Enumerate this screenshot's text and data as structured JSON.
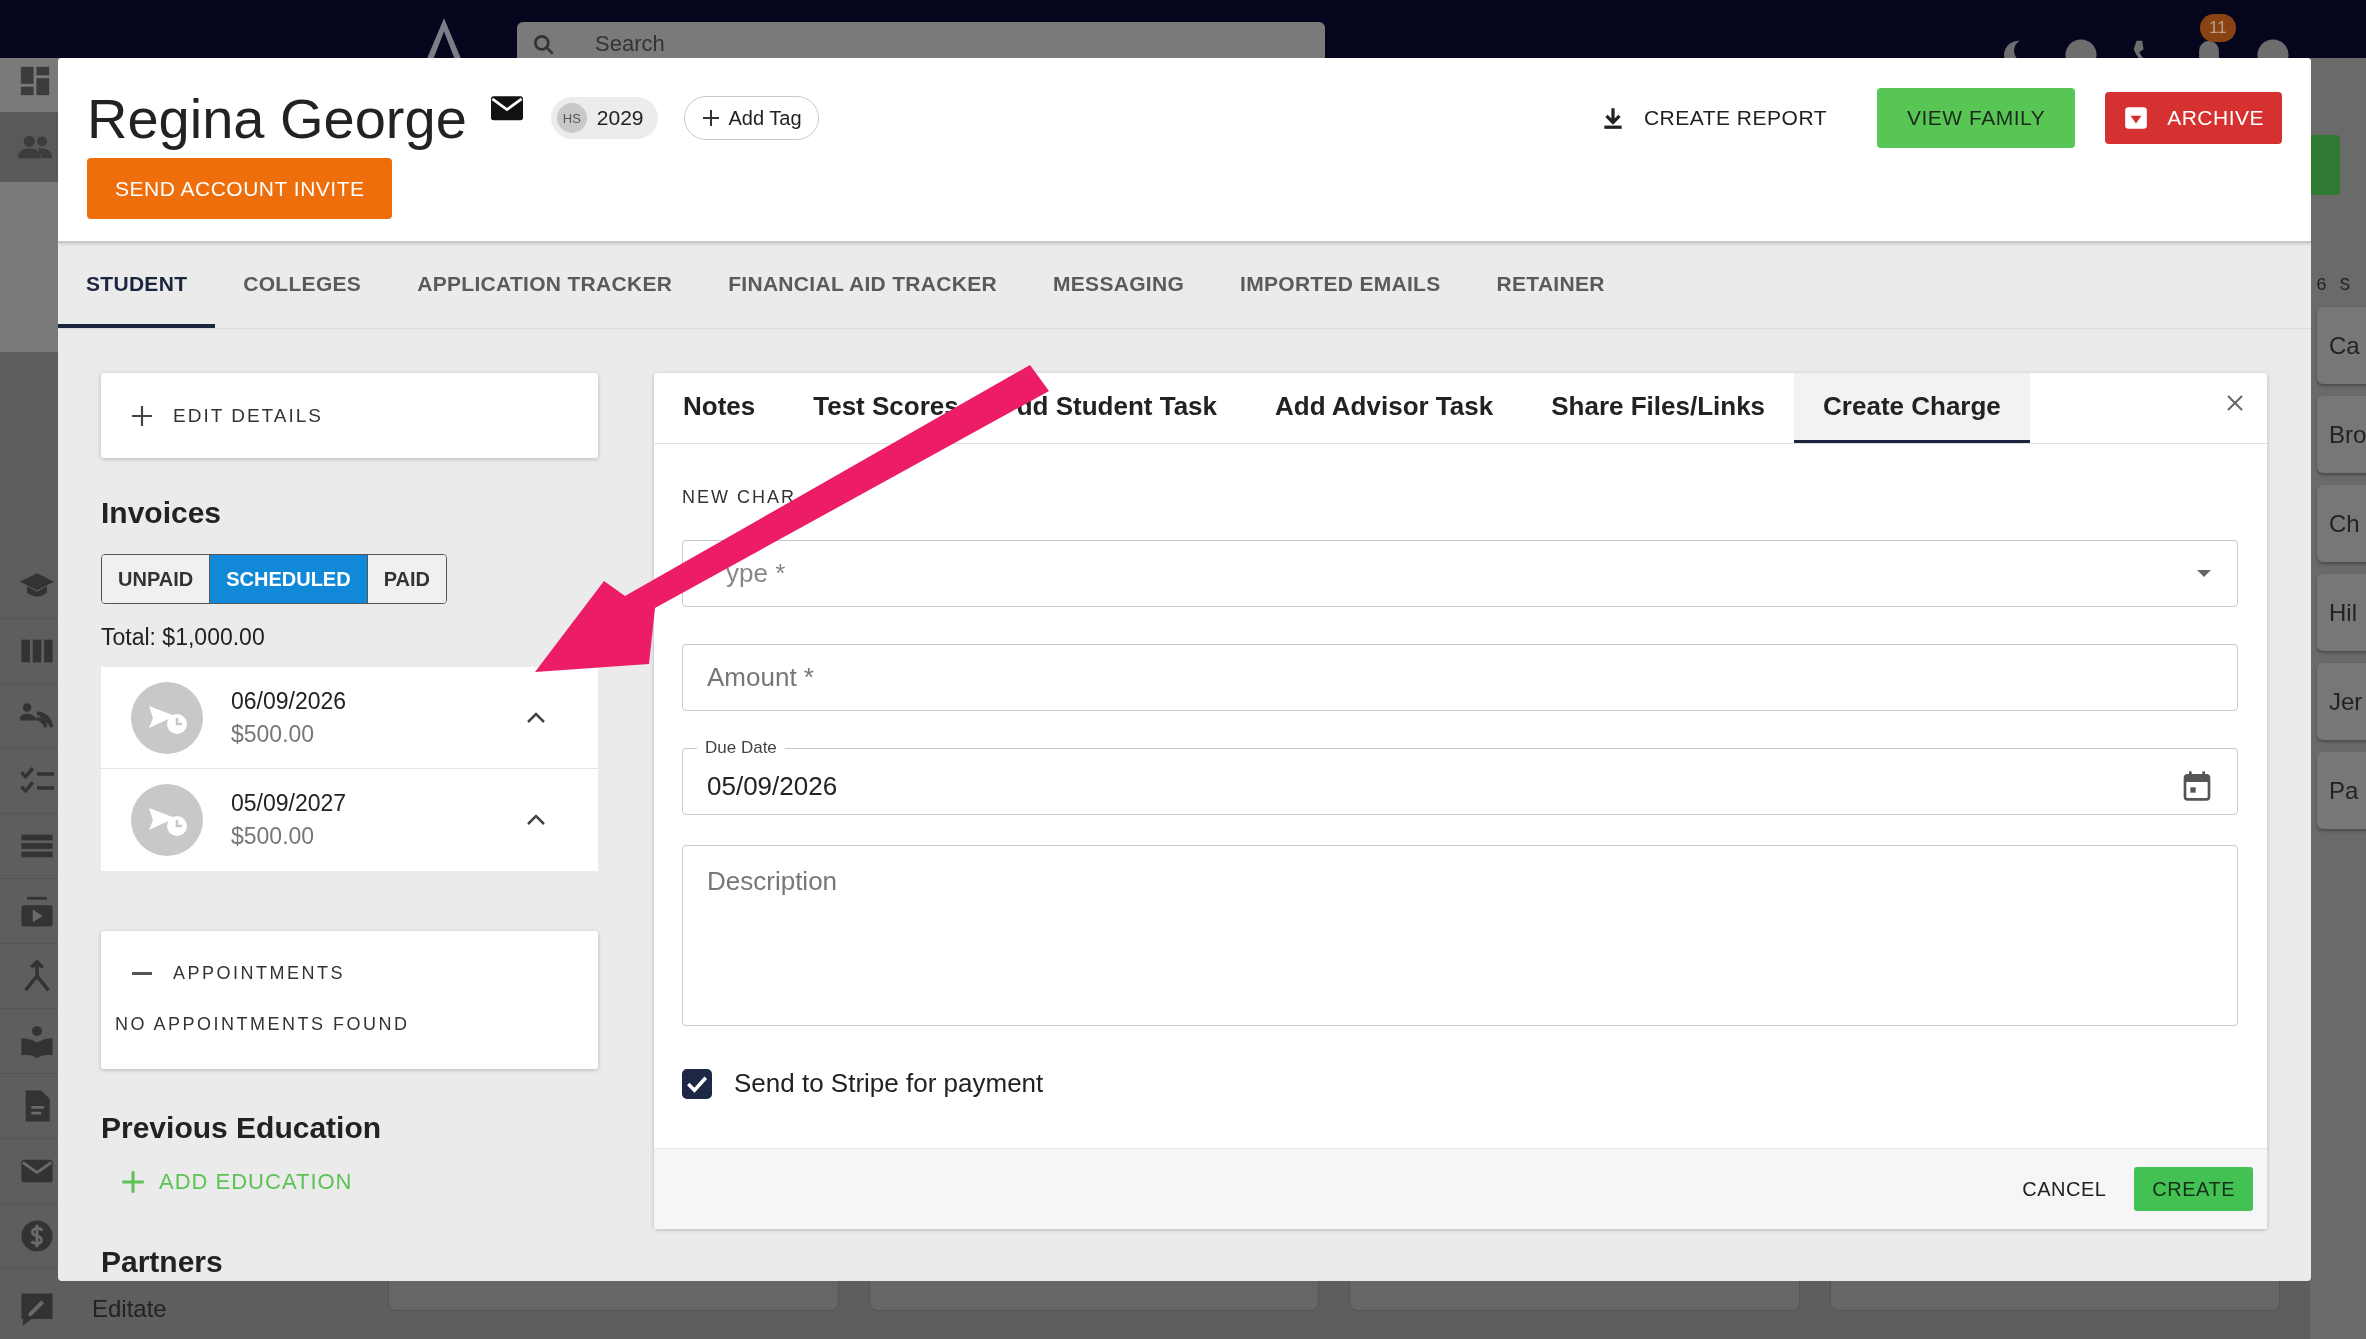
{
  "top_bar": {
    "search": {
      "placeholder": "Search"
    },
    "notification_count": "11"
  },
  "sidebar": {
    "footer_item": "Editate"
  },
  "right_list": {
    "heading": "6 S",
    "items": [
      "Ca",
      "Bro",
      "Ch",
      "Hil",
      "Jer",
      "Pa"
    ]
  },
  "student_modal": {
    "name": "Regina George",
    "grade_chip": {
      "avatar": "HS",
      "label": "2029"
    },
    "add_tag": "Add Tag",
    "send_invite": "SEND ACCOUNT INVITE",
    "actions": [
      {
        "kind": "text",
        "label": "CREATE REPORT"
      },
      {
        "kind": "success",
        "label": "VIEW FAMILY"
      },
      {
        "kind": "danger",
        "label": "ARCHIVE"
      }
    ],
    "tabs": [
      {
        "label": "STUDENT",
        "selected": true
      },
      {
        "label": "COLLEGES",
        "selected": false
      },
      {
        "label": "APPLICATION TRACKER",
        "selected": false
      },
      {
        "label": "FINANCIAL AID TRACKER",
        "selected": false
      },
      {
        "label": "MESSAGING",
        "selected": false
      },
      {
        "label": "IMPORTED EMAILS",
        "selected": false
      },
      {
        "label": "RETAINER",
        "selected": false
      }
    ],
    "edit_details": "EDIT DETAILS",
    "invoices": {
      "title": "Invoices",
      "filters": [
        {
          "label": "UNPAID",
          "selected": false
        },
        {
          "label": "SCHEDULED",
          "selected": true
        },
        {
          "label": "PAID",
          "selected": false
        }
      ],
      "total": "Total: $1,000.00",
      "items": [
        {
          "date": "06/09/2026",
          "amount": "$500.00"
        },
        {
          "date": "05/09/2027",
          "amount": "$500.00"
        }
      ]
    },
    "appointments": {
      "title": "APPOINTMENTS",
      "empty": "NO APPOINTMENTS FOUND"
    },
    "previous_education": {
      "title": "Previous Education",
      "add": "ADD EDUCATION"
    },
    "partners": {
      "title": "Partners"
    },
    "panel": {
      "tabs": [
        {
          "label": "Notes",
          "selected": false
        },
        {
          "label": "Test Scores",
          "selected": false
        },
        {
          "label": "dd Student Task",
          "selected": false
        },
        {
          "label": "Add Advisor Task",
          "selected": false
        },
        {
          "label": "Share Files/Links",
          "selected": false
        },
        {
          "label": "Create Charge",
          "selected": true
        }
      ],
      "section": "NEW CHAR",
      "fields": [
        {
          "kind": "select",
          "placeholder": "ype *"
        },
        {
          "kind": "text",
          "placeholder": "Amount *"
        },
        {
          "kind": "date",
          "label": "Due Date",
          "value": "05/09/2026"
        },
        {
          "kind": "textarea",
          "placeholder": "Description"
        }
      ],
      "stripe": {
        "label": "Send to Stripe for payment",
        "checked": true
      },
      "cancel": "CANCEL",
      "create": "CREATE"
    }
  }
}
